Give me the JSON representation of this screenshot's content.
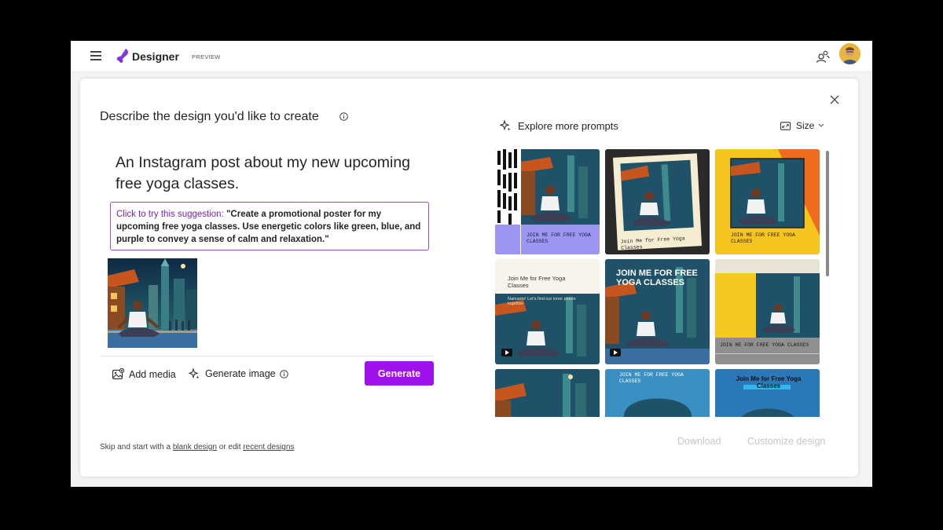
{
  "app": {
    "brand": "Designer",
    "badge": "PREVIEW"
  },
  "dialog": {
    "heading": "Describe the design you'd like to create",
    "prompt": "An Instagram post about my new upcoming free yoga classes.",
    "suggestion_lead": "Click to try this suggestion:",
    "suggestion_text": " \"Create a promotional poster for my upcoming free yoga classes. Use energetic colors like green, blue, and purple to convey a sense of calm and relaxation.\"",
    "add_media": "Add media",
    "generate_image": "Generate image",
    "generate": "Generate",
    "skip_prefix": "Skip and start with a ",
    "blank_design": "blank design",
    "skip_middle": " or edit ",
    "recent_designs": "recent designs"
  },
  "right": {
    "explore": "Explore more prompts",
    "size": "Size",
    "download": "Download",
    "customize": "Customize design"
  },
  "cards": [
    {
      "caption": "JOIN ME FOR FREE YOGA CLASSES"
    },
    {
      "caption": "Join Me for Free Yoga Classes"
    },
    {
      "caption": "JOIN ME FOR FREE YOGA CLASSES"
    },
    {
      "caption": "Join Me for Free Yoga Classes",
      "subcaption": "Namaste! Let's find our inner peace together"
    },
    {
      "caption": "JOIN ME FOR FREE YOGA CLASSES"
    },
    {
      "caption": "JOIN ME FOR FREE YOGA CLASSES"
    },
    {
      "caption": ""
    },
    {
      "caption": "JOIN ME FOR FREE YOGA CLASSES"
    },
    {
      "caption": "Join Me for Free Yoga Classes"
    }
  ],
  "colors": {
    "accent": "#9f12ec",
    "suggestion_border": "#9b4fd0",
    "suggestion_lead": "#7a1fb7"
  }
}
